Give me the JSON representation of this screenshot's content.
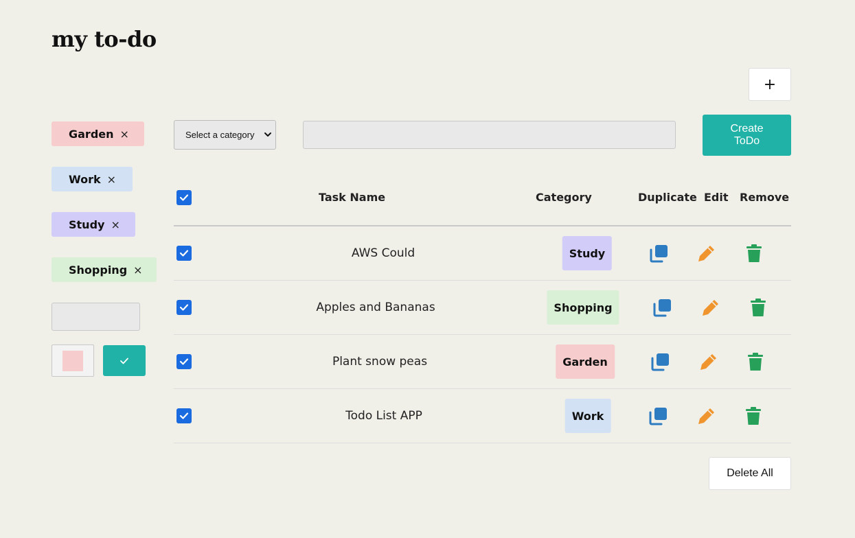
{
  "app": {
    "title": "my to-do",
    "add_label": "+"
  },
  "colors": {
    "accent": "#20b2a6",
    "checkbox": "#1a6ae0",
    "duplicate": "#2d7bc0",
    "edit": "#f0952e",
    "remove": "#27a05a",
    "garden": "#f7cccc",
    "work": "#d2e2f4",
    "study": "#d2ccf8",
    "shopping": "#d9efd6"
  },
  "sidebar": {
    "categories": [
      {
        "label": "Garden",
        "remove": "×",
        "color": "#f7cccc"
      },
      {
        "label": "Work",
        "remove": "×",
        "color": "#d2e2f4"
      },
      {
        "label": "Study",
        "remove": "×",
        "color": "#d2ccf8"
      },
      {
        "label": "Shopping",
        "remove": "×",
        "color": "#d9efd6"
      }
    ],
    "new_category_value": "",
    "selected_color": "#f7cccc",
    "confirm_icon": "check-icon"
  },
  "toolbar": {
    "category_select": {
      "selected": "Select a category"
    },
    "task_input_value": "",
    "create_label": "Create ToDo"
  },
  "table": {
    "headers": {
      "task": "Task Name",
      "category": "Category",
      "duplicate": "Duplicate",
      "edit": "Edit",
      "remove": "Remove"
    },
    "all_checked": true,
    "rows": [
      {
        "checked": true,
        "task": "AWS Could",
        "category": "Study",
        "color": "#d2ccf8"
      },
      {
        "checked": true,
        "task": "Apples and Bananas",
        "category": "Shopping",
        "color": "#d9efd6"
      },
      {
        "checked": true,
        "task": "Plant snow peas",
        "category": "Garden",
        "color": "#f7cccc"
      },
      {
        "checked": true,
        "task": "Todo List APP",
        "category": "Work",
        "color": "#d2e2f4"
      }
    ]
  },
  "footer": {
    "delete_all_label": "Delete All"
  }
}
